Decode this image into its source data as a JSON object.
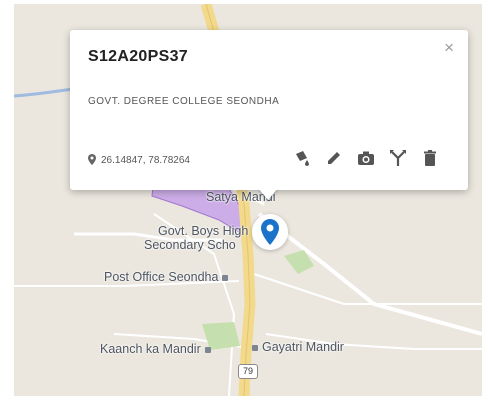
{
  "map": {
    "labels": {
      "satya_mandir": "Satya Mandi",
      "boys_school_line1": "Govt. Boys High",
      "boys_school_line2": "Secondary Scho",
      "post_office": "Post Office Seondha",
      "kaanch_mandir": "Kaanch ka Mandir",
      "gayatri_mandir": "Gayatri Mandir",
      "highway_shield": "79"
    }
  },
  "popup": {
    "title": "S12A20PS37",
    "close_symbol": "×",
    "description": "GOVT. DEGREE COLLEGE SEONDHA",
    "coordinates": "26.14847, 78.78264",
    "actions": [
      "style-icon",
      "edit-icon",
      "camera-icon",
      "directions-icon",
      "delete-icon"
    ]
  },
  "colors": {
    "marker": "#1a73c8",
    "polygon_fill": "#c9a7e8",
    "park_green": "#c6dfae",
    "main_road": "#f2d98c"
  }
}
